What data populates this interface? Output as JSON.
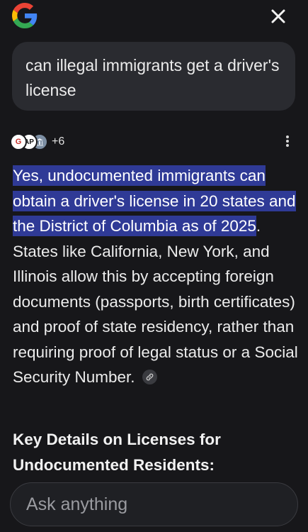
{
  "header": {
    "logo_icon": "google-g-icon",
    "close_icon": "close-icon"
  },
  "query": {
    "text": "can illegal immigrants get a driver's license"
  },
  "sources": {
    "icons": [
      "google-news-icon",
      "ap-icon",
      "government-icon"
    ],
    "icon_letters": [
      "G",
      "AP",
      ""
    ],
    "more_count": "+6",
    "menu_icon": "more-vertical-icon"
  },
  "answer": {
    "highlighted": "Yes, undocumented immigrants can obtain a driver's license in 20 states and the District of Columbia as of 2025",
    "rest": ". States like California, New York, and Illinois allow this by accepting foreign documents (passports, birth certificates) and proof of state residency, rather than requiring proof of legal status or a Social Security Number.",
    "link_icon": "link-icon"
  },
  "section": {
    "heading": "Key Details on Licenses for Undocumented Residents:"
  },
  "ask": {
    "placeholder": "Ask anything"
  },
  "colors": {
    "background": "#17171a",
    "bubble": "#2a2b30",
    "highlight": "#2f3a96",
    "text": "#ececec"
  }
}
